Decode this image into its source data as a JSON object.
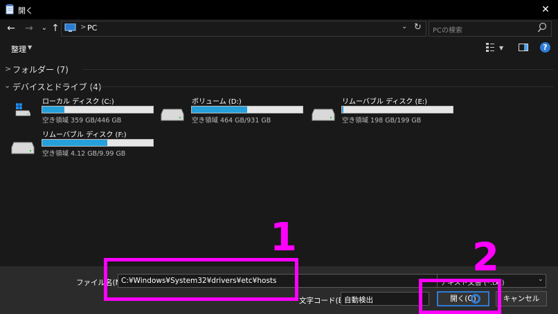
{
  "window": {
    "title": "開く",
    "close_glyph": "✕"
  },
  "nav": {
    "back_glyph": "←",
    "forward_glyph": "→",
    "recent_glyph": "⌄",
    "up_glyph": "↑",
    "breadcrumb_sep": ">",
    "location": "PC",
    "dropdown_glyph": "⌄",
    "refresh_glyph": "↻",
    "search_placeholder": "PCの検索"
  },
  "toolbar": {
    "organize_label": "整理",
    "caret": "▼"
  },
  "groups": [
    {
      "label": "フォルダー (7)",
      "collapsed": true,
      "chevron": ">"
    },
    {
      "label": "デバイスとドライブ (4)",
      "collapsed": false,
      "chevron": "⌄"
    }
  ],
  "drives": [
    {
      "name": "ローカル ディスク (C:)",
      "free_text": "空き領域 359 GB/446 GB",
      "used_fraction": 0.2
    },
    {
      "name": "ボリューム (D:)",
      "free_text": "空き領域 464 GB/931 GB",
      "used_fraction": 0.5
    },
    {
      "name": "リムーバブル ディスク (E:)",
      "free_text": "空き領域 198 GB/199 GB",
      "used_fraction": 0.01
    },
    {
      "name": "リムーバブル ディスク (F:)",
      "free_text": "空き領域 4.12 GB/9.99 GB",
      "used_fraction": 0.59
    }
  ],
  "bottom": {
    "filename_label": "ファイル名(N):",
    "filename_value": "C:¥Windows¥System32¥drivers¥etc¥hosts",
    "filter_value": "テキスト文書 (*.txt)",
    "encoding_label": "文字コード(E):",
    "encoding_value": "自動検出",
    "open_label": "開く(O)",
    "cancel_label": "キャンセル"
  },
  "annotations": {
    "one": "1",
    "two": "2",
    "color": "#ff00ff"
  },
  "colors": {
    "accent": "#2f7cd6",
    "drive_bar": "#26a0da",
    "background": "#191919",
    "annotation": "#ff00ff"
  }
}
